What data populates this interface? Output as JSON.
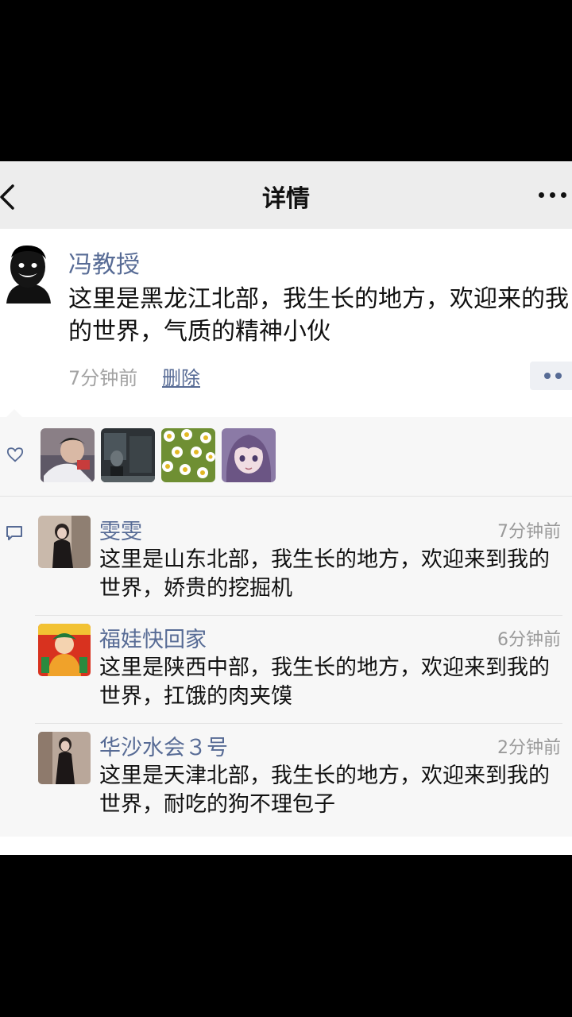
{
  "navbar": {
    "title": "详情",
    "back_icon": "chevron-left-icon",
    "more_icon": "more-dots-icon"
  },
  "post": {
    "author": "冯教授",
    "text": "这里是黑龙江北部，我生长的地方，欢迎来的我的世界，气质的精神小伙",
    "time": "7分钟前",
    "delete_label": "删除",
    "action_icon": "comment-like-dots-icon"
  },
  "likes": {
    "icon": "heart-icon",
    "avatars": [
      {
        "name": "like-avatar-photo-1"
      },
      {
        "name": "like-avatar-photo-2"
      },
      {
        "name": "like-avatar-daisies"
      },
      {
        "name": "like-avatar-anime-girl"
      }
    ]
  },
  "comments": {
    "icon": "comment-bubble-icon",
    "items": [
      {
        "name": "雯雯",
        "time": "7分钟前",
        "text": "这里是山东北部，我生长的地方，欢迎来到我的世界，娇贵的挖掘机"
      },
      {
        "name": "福娃快回家",
        "time": "6分钟前",
        "text": "这里是陕西中部，我生长的地方，欢迎来到我的世界，扛饿的肉夹馍"
      },
      {
        "name": "华沙水会３号",
        "time": "2分钟前",
        "text": "这里是天津北部，我生长的地方，欢迎来到我的世界，耐吃的狗不理包子"
      }
    ]
  },
  "colors": {
    "link_blue": "#576b95",
    "navbar_bg": "#ededed",
    "panel_bg": "#f7f7f7",
    "letterbox": "#000000"
  }
}
